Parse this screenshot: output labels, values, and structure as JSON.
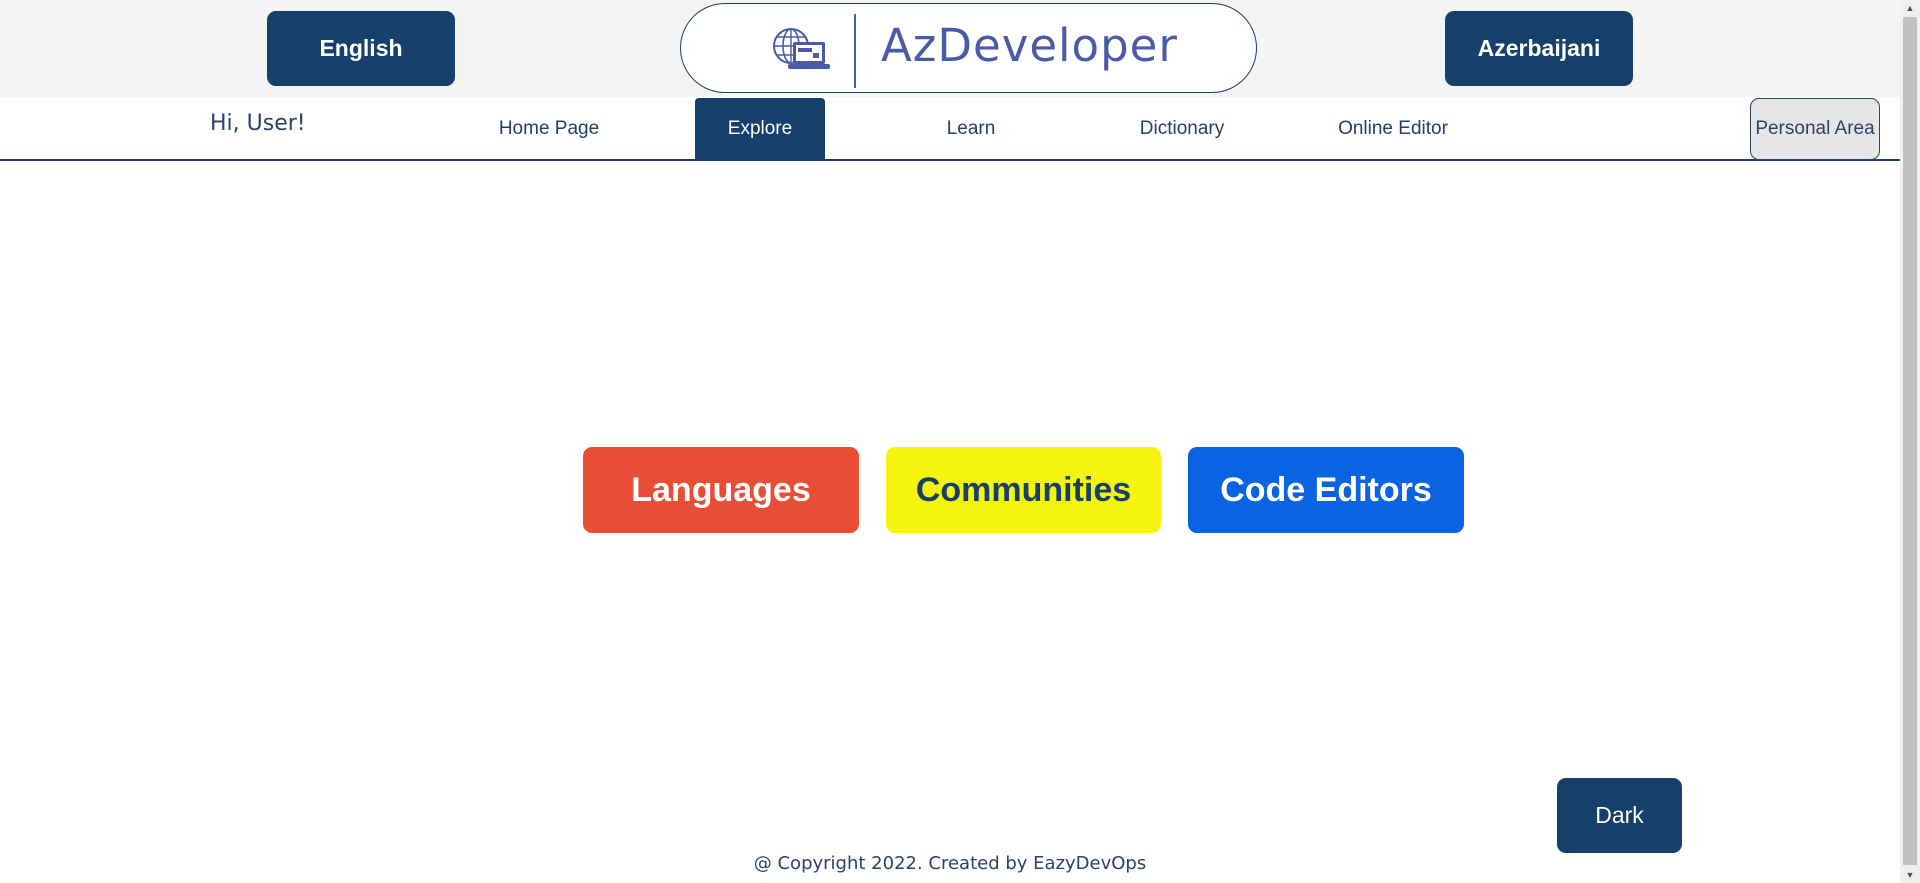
{
  "header": {
    "lang_left": "English",
    "lang_right": "Azerbaijani",
    "logo_text": "AzDeveloper"
  },
  "nav": {
    "greeting": "Hi, User!",
    "items": [
      {
        "label": "Home Page",
        "active": false
      },
      {
        "label": "Explore",
        "active": true
      },
      {
        "label": "Learn",
        "active": false
      },
      {
        "label": "Dictionary",
        "active": false
      },
      {
        "label": "Online Editor",
        "active": false
      }
    ],
    "personal_area": "Personal Area"
  },
  "main": {
    "buttons": [
      {
        "label": "Languages",
        "color": "#e84e36"
      },
      {
        "label": "Communities",
        "color": "#f4f40f"
      },
      {
        "label": "Code Editors",
        "color": "#0a63e0"
      }
    ]
  },
  "theme_toggle": "Dark",
  "footer": "@ Copyright 2022. Created by EazyDevOps",
  "colors": {
    "primary": "#163f6b",
    "logo": "#4a5aa8",
    "header_bg": "#f4f4f4"
  },
  "icons": {
    "logo": "globe-laptop-icon",
    "scroll_up": "scroll-up-arrow-icon",
    "scroll_down": "scroll-down-arrow-icon"
  }
}
